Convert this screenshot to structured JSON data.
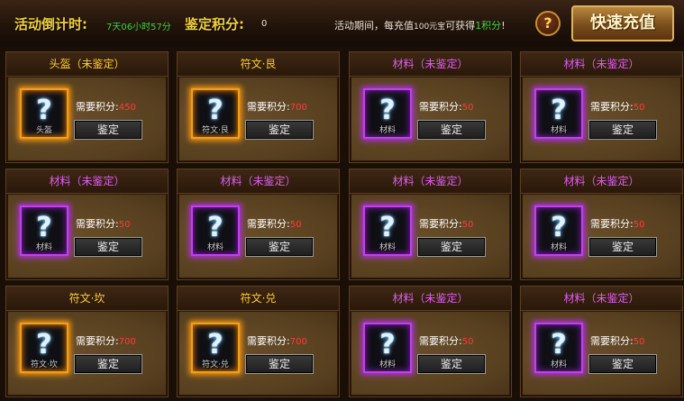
{
  "header": {
    "countdown_label": "活动倒计时:",
    "countdown_value": "7天06小时57分",
    "points_label": "鉴定积分:",
    "points_value": "0",
    "notice_prefix": "活动期间，每充值",
    "notice_amount": "100元宝",
    "notice_middle": "可获得",
    "notice_reward": "1积分",
    "notice_suffix": "!",
    "help_label": "?",
    "recharge_label": "快速充值"
  },
  "cost_label": "需要积分:",
  "appraise_label": "鉴定",
  "cards": [
    {
      "title": "头盔（未鉴定）",
      "tier": "gold",
      "caption": "头盔",
      "cost": "450"
    },
    {
      "title": "符文·艮",
      "tier": "gold",
      "caption": "符文·艮",
      "cost": "700"
    },
    {
      "title": "材料（未鉴定）",
      "tier": "purple",
      "caption": "材料",
      "cost": "50"
    },
    {
      "title": "材料（未鉴定）",
      "tier": "purple",
      "caption": "材料",
      "cost": "50"
    },
    {
      "title": "材料（未鉴定）",
      "tier": "purple",
      "caption": "材料",
      "cost": "50"
    },
    {
      "title": "材料（未鉴定）",
      "tier": "purple",
      "caption": "材料",
      "cost": "50"
    },
    {
      "title": "材料（未鉴定）",
      "tier": "purple",
      "caption": "材料",
      "cost": "50"
    },
    {
      "title": "材料（未鉴定）",
      "tier": "purple",
      "caption": "材料",
      "cost": "50"
    },
    {
      "title": "符文·坎",
      "tier": "gold",
      "caption": "符文·坎",
      "cost": "700"
    },
    {
      "title": "符文·兑",
      "tier": "gold",
      "caption": "符文·兑",
      "cost": "700"
    },
    {
      "title": "材料（未鉴定）",
      "tier": "purple",
      "caption": "材料",
      "cost": "50"
    },
    {
      "title": "材料（未鉴定）",
      "tier": "purple",
      "caption": "材料",
      "cost": "50"
    }
  ]
}
